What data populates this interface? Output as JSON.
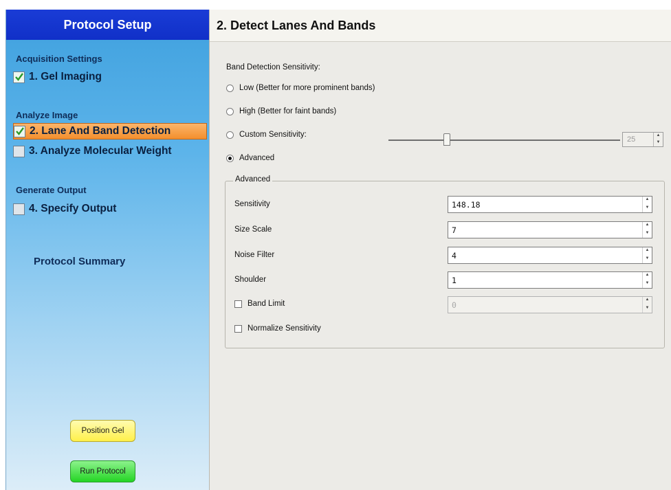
{
  "sidebar": {
    "title": "Protocol Setup",
    "sections": {
      "acquisition": "Acquisition Settings",
      "analyze": "Analyze Image",
      "output": "Generate Output"
    },
    "steps": [
      {
        "label": "1. Gel Imaging",
        "checked": true,
        "active": false
      },
      {
        "label": "2. Lane And Band Detection",
        "checked": true,
        "active": true
      },
      {
        "label": "3. Analyze Molecular Weight",
        "checked": false,
        "active": false
      },
      {
        "label": "4. Specify Output",
        "checked": false,
        "active": false
      }
    ],
    "summary_link": "Protocol Summary",
    "position_gel_button": "Position Gel",
    "run_protocol_button": "Run Protocol"
  },
  "panel": {
    "title": "2. Detect Lanes And Bands",
    "sensitivity_heading": "Band Detection Sensitivity:",
    "options": {
      "low": "Low (Better for more prominent bands)",
      "high": "High (Better for faint bands)",
      "custom": "Custom Sensitivity:",
      "advanced": "Advanced"
    },
    "selected_option": "advanced",
    "custom_sensitivity_value": "25",
    "custom_slider_fraction": 0.25,
    "advanced_group": {
      "legend": "Advanced",
      "sensitivity_label": "Sensitivity",
      "sensitivity_value": "148.18",
      "size_scale_label": "Size Scale",
      "size_scale_value": "7",
      "noise_filter_label": "Noise Filter",
      "noise_filter_value": "4",
      "shoulder_label": "Shoulder",
      "shoulder_value": "1",
      "band_limit_label": "Band Limit",
      "band_limit_value": "0",
      "band_limit_checked": false,
      "normalize_label": "Normalize Sensitivity",
      "normalize_checked": false
    }
  },
  "colors": {
    "sidebar_header": "#1030c8",
    "active_step": "#f38f2d",
    "position_gel": "#fff04a",
    "run_protocol": "#24d524"
  }
}
